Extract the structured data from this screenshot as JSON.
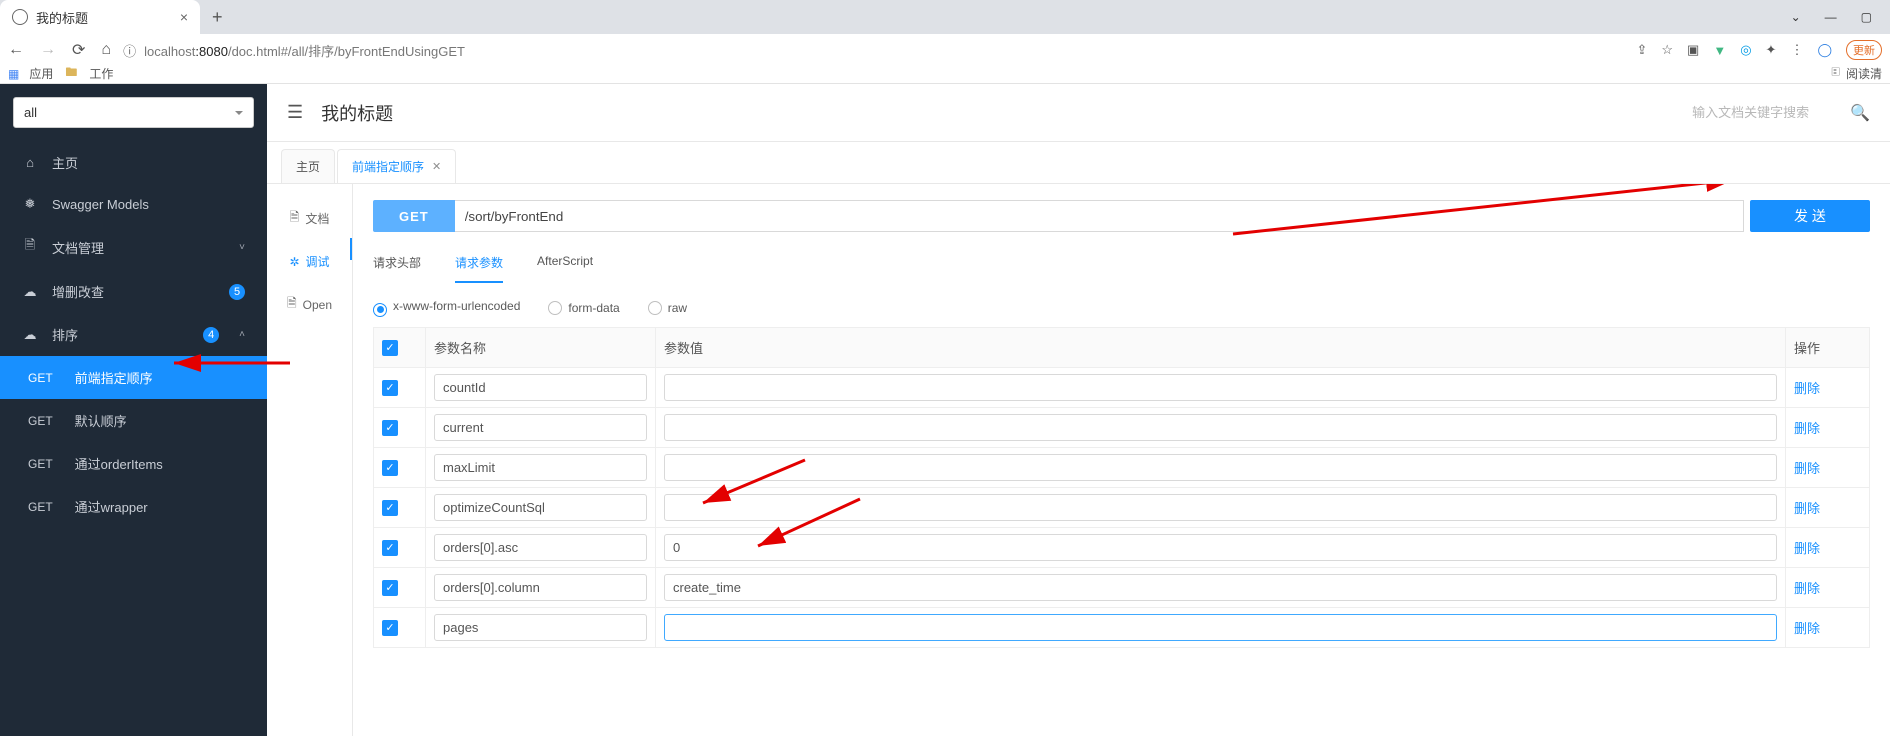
{
  "browser": {
    "tab_title": "我的标题",
    "url_prefix": "localhost",
    "url_port": ":8080",
    "url_path_gray": "/doc.html#/all/排序/byFrontEndUsingGET",
    "update_label": "更新",
    "bookmarks": {
      "apps": "应用",
      "work": "工作",
      "reader": "阅读清"
    }
  },
  "sidebar": {
    "selector": "all",
    "items": [
      {
        "icon": "⌂",
        "label": "主页"
      },
      {
        "icon": "❅",
        "label": "Swagger Models"
      },
      {
        "icon": "🗎",
        "label": "文档管理",
        "expandable": true
      },
      {
        "icon": "☁",
        "label": "增删改查",
        "badge": "5"
      },
      {
        "icon": "☁",
        "label": "排序",
        "badge": "4",
        "expanded": true,
        "children": [
          {
            "verb": "GET",
            "label": "前端指定顺序",
            "active": true
          },
          {
            "verb": "GET",
            "label": "默认顺序"
          },
          {
            "verb": "GET",
            "label": "通过orderItems"
          },
          {
            "verb": "GET",
            "label": "通过wrapper"
          }
        ]
      }
    ]
  },
  "header": {
    "title": "我的标题",
    "search_placeholder": "输入文档关键字搜索"
  },
  "page_tabs": [
    {
      "label": "主页",
      "closable": false
    },
    {
      "label": "前端指定顺序",
      "closable": true,
      "active": true
    }
  ],
  "v_tabs": [
    {
      "icon": "🗎",
      "label": "文档"
    },
    {
      "icon": "✲",
      "label": "调试",
      "active": true
    },
    {
      "icon": "🗎",
      "label": "Open"
    }
  ],
  "request": {
    "verb": "GET",
    "path": "/sort/byFrontEnd",
    "send": "发 送"
  },
  "sub_tabs": [
    {
      "label": "请求头部"
    },
    {
      "label": "请求参数",
      "active": true
    },
    {
      "label": "AfterScript"
    }
  ],
  "body_types": [
    {
      "label": "x-www-form-urlencoded",
      "checked": true
    },
    {
      "label": "form-data"
    },
    {
      "label": "raw"
    }
  ],
  "params_header": {
    "name": "参数名称",
    "value": "参数值",
    "op": "操作"
  },
  "params": [
    {
      "checked": true,
      "name": "countId",
      "value": ""
    },
    {
      "checked": true,
      "name": "current",
      "value": ""
    },
    {
      "checked": true,
      "name": "maxLimit",
      "value": ""
    },
    {
      "checked": true,
      "name": "optimizeCountSql",
      "value": ""
    },
    {
      "checked": true,
      "name": "orders[0].asc",
      "value": "0"
    },
    {
      "checked": true,
      "name": "orders[0].column",
      "value": "create_time"
    },
    {
      "checked": true,
      "name": "pages",
      "value": ""
    }
  ],
  "delete_label": "删除"
}
